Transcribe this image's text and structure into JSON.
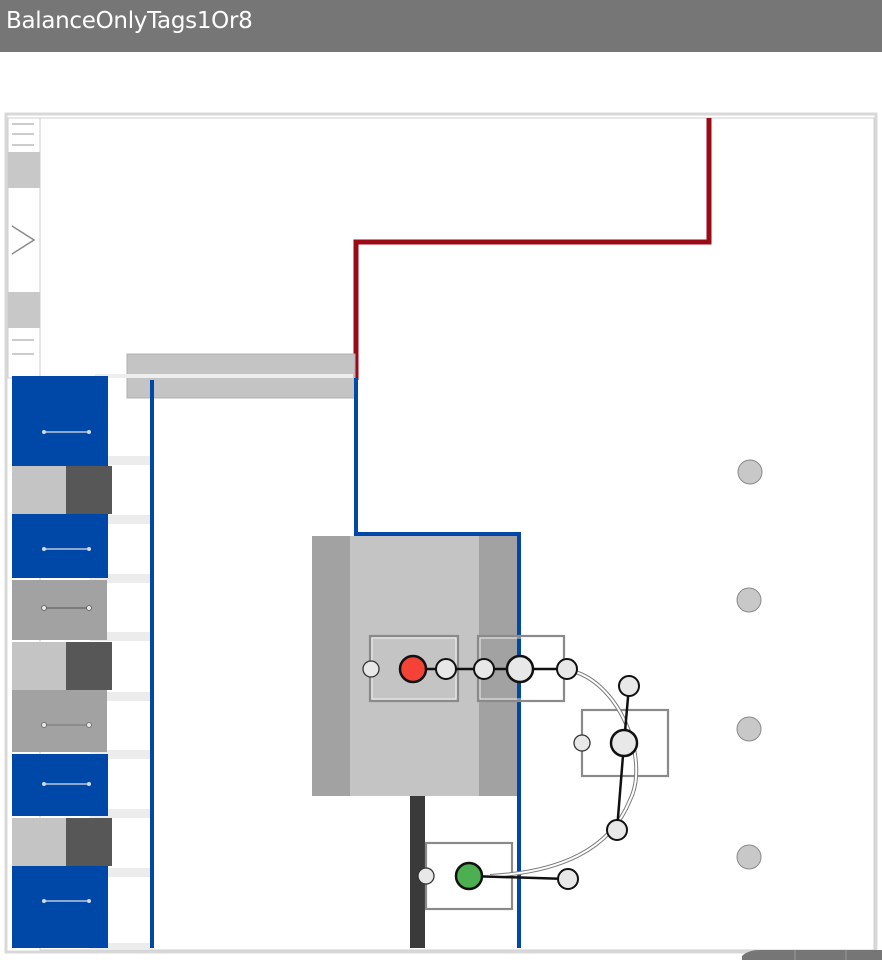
{
  "window": {
    "title": "BalanceOnlyTags1Or8"
  },
  "colors": {
    "titlebar": "#767676",
    "path_red": "#9b0a17",
    "path_blue": "#0048a8",
    "module_blue": "#0048a8",
    "active_tag": "#f44336",
    "ok_tag": "#4caf50",
    "node_fill": "#e8e8e8",
    "marker_grey": "#c8c8c8"
  },
  "palette": {
    "sections": [
      {
        "name": "blue-module",
        "kind": "blue"
      },
      {
        "name": "split-module",
        "kind": "split"
      },
      {
        "name": "blue-module",
        "kind": "blue"
      },
      {
        "name": "grey-module",
        "kind": "grey"
      },
      {
        "name": "split-module",
        "kind": "split"
      },
      {
        "name": "grey-module",
        "kind": "grey"
      },
      {
        "name": "blue-module",
        "kind": "blue"
      },
      {
        "name": "split-module",
        "kind": "split"
      },
      {
        "name": "blue-module",
        "kind": "blue"
      }
    ]
  },
  "graph": {
    "nodes": [
      {
        "name": "tag-node-red",
        "state": "active"
      },
      {
        "name": "tag-node-green",
        "state": "ok"
      },
      {
        "name": "junction-node",
        "state": "normal"
      }
    ]
  }
}
